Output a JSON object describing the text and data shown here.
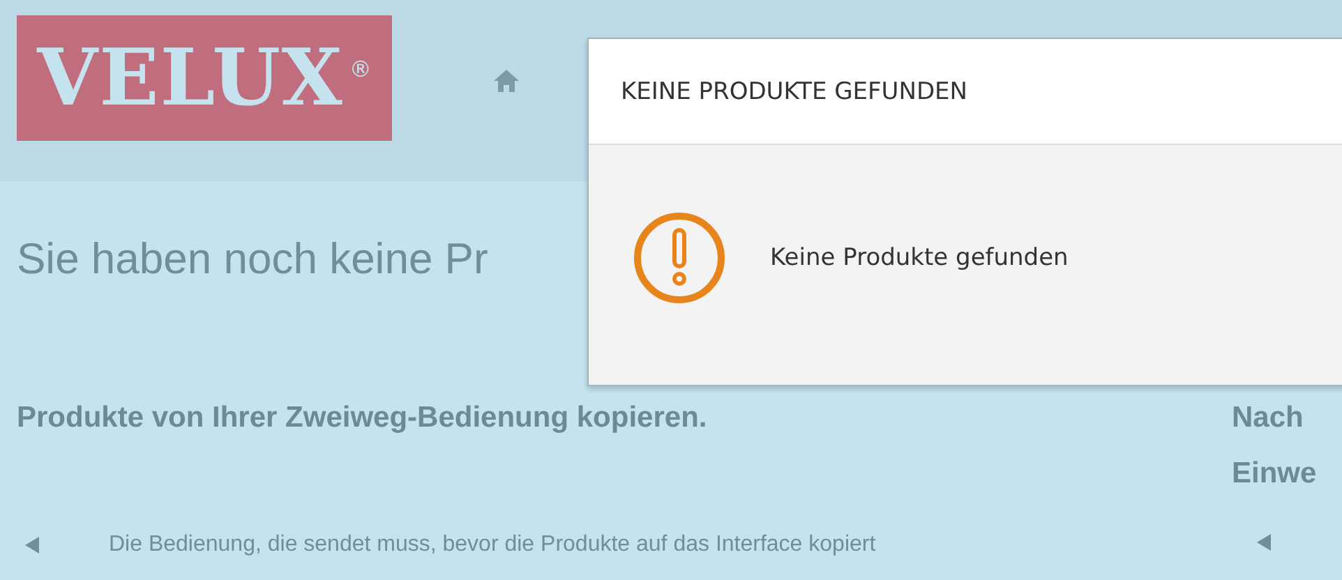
{
  "header": {
    "logo": "VELUX",
    "logo_mark": "®"
  },
  "page": {
    "title": "Sie haben noch keine Pr",
    "sections": [
      {
        "heading": "Produkte von Ihrer Zweiweg-Bedienung kopieren.",
        "text": "Die Bedienung, die sendet muss, bevor die Produkte auf das Interface kopiert"
      },
      {
        "heading_lines": [
          "Nach",
          "Einwe"
        ]
      }
    ]
  },
  "dialog": {
    "title": "KEINE PRODUKTE GEFUNDEN",
    "message": "Keine Produkte gefunden"
  }
}
